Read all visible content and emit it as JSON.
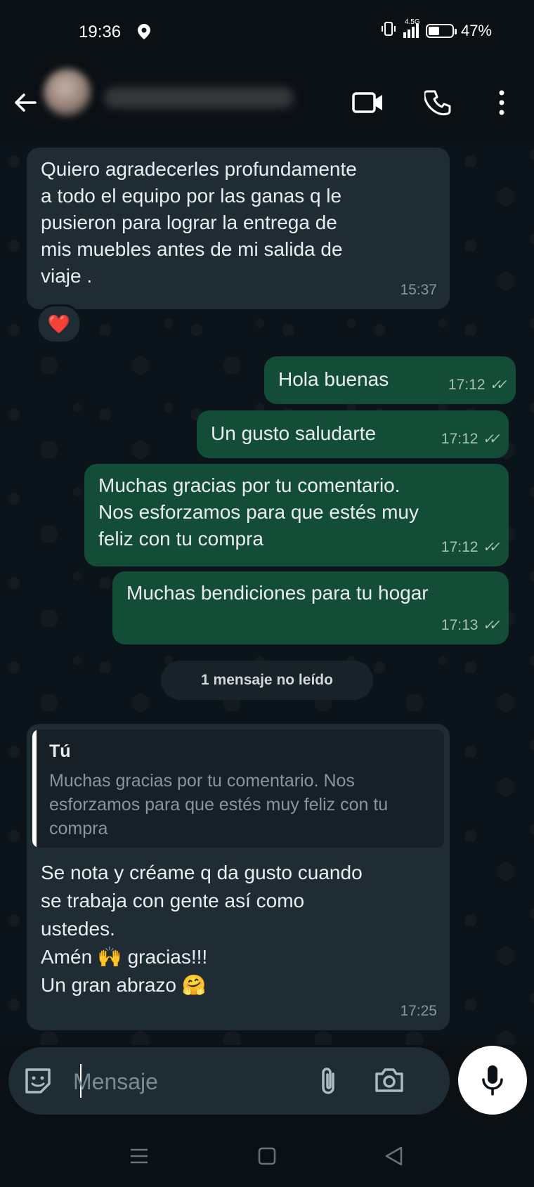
{
  "status_bar": {
    "time": "19:36",
    "network": "4.5G",
    "battery": "47%",
    "battery_level": 0.47
  },
  "header": {
    "contact_name": "",
    "icons": [
      "back-arrow-icon",
      "video-call-icon",
      "voice-call-icon",
      "more-options-icon"
    ]
  },
  "messages": [
    {
      "direction": "in",
      "text": "Quiero agradecerles profundamente\na todo el equipo por las ganas q le\npusieron para lograr la entrega de\nmis muebles antes de mi salida de\nviaje .",
      "time": "15:37",
      "reaction": "❤️"
    },
    {
      "direction": "out",
      "text": "Hola buenas",
      "time": "17:12"
    },
    {
      "direction": "out",
      "text": "Un gusto saludarte",
      "time": "17:12"
    },
    {
      "direction": "out",
      "text": "Muchas gracias por tu comentario.\nNos esforzamos para que estés muy\nfeliz con tu compra",
      "time": "17:12"
    },
    {
      "direction": "out",
      "text": "Muchas bendiciones para tu hogar",
      "time": "17:13"
    }
  ],
  "unread_banner": "1 mensaje no leído",
  "reply": {
    "quote_author": "Tú",
    "quote_text": "Muchas gracias por tu comentario. Nos esforzamos para que estés muy feliz con tu compra",
    "text": "Se nota y créame q da gusto cuando\nse trabaja con gente así como\nustedes.\nAmén 🙌 gracias!!!\nUn gran abrazo 🤗",
    "time": "17:25"
  },
  "composer": {
    "placeholder": "Mensaje"
  },
  "colors": {
    "incoming_bubble": "#1f2c34",
    "outgoing_bubble": "#134d37",
    "background": "#0b141a"
  }
}
